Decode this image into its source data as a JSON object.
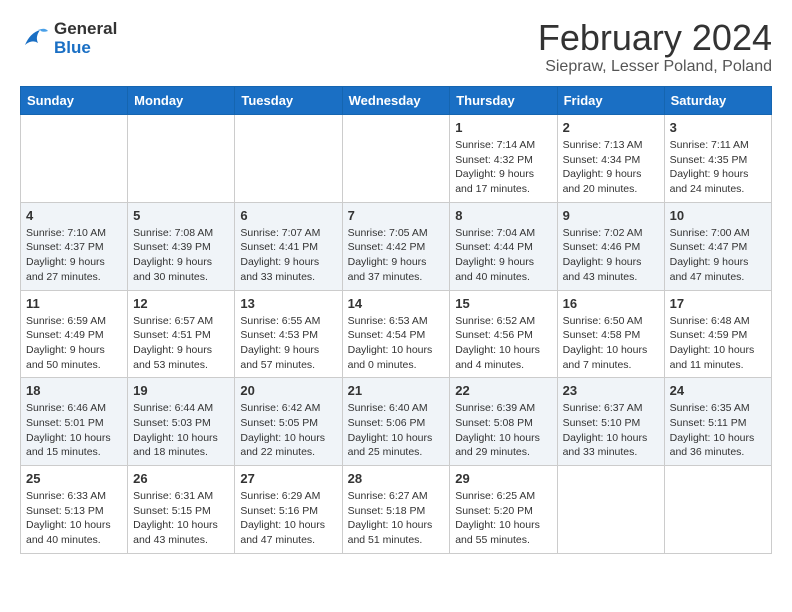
{
  "header": {
    "logo": {
      "general": "General",
      "blue": "Blue"
    },
    "title": "February 2024",
    "location": "Siepraw, Lesser Poland, Poland"
  },
  "days_of_week": [
    "Sunday",
    "Monday",
    "Tuesday",
    "Wednesday",
    "Thursday",
    "Friday",
    "Saturday"
  ],
  "weeks": [
    [
      {
        "day": "",
        "info": ""
      },
      {
        "day": "",
        "info": ""
      },
      {
        "day": "",
        "info": ""
      },
      {
        "day": "",
        "info": ""
      },
      {
        "day": "1",
        "info": "Sunrise: 7:14 AM\nSunset: 4:32 PM\nDaylight: 9 hours\nand 17 minutes."
      },
      {
        "day": "2",
        "info": "Sunrise: 7:13 AM\nSunset: 4:34 PM\nDaylight: 9 hours\nand 20 minutes."
      },
      {
        "day": "3",
        "info": "Sunrise: 7:11 AM\nSunset: 4:35 PM\nDaylight: 9 hours\nand 24 minutes."
      }
    ],
    [
      {
        "day": "4",
        "info": "Sunrise: 7:10 AM\nSunset: 4:37 PM\nDaylight: 9 hours\nand 27 minutes."
      },
      {
        "day": "5",
        "info": "Sunrise: 7:08 AM\nSunset: 4:39 PM\nDaylight: 9 hours\nand 30 minutes."
      },
      {
        "day": "6",
        "info": "Sunrise: 7:07 AM\nSunset: 4:41 PM\nDaylight: 9 hours\nand 33 minutes."
      },
      {
        "day": "7",
        "info": "Sunrise: 7:05 AM\nSunset: 4:42 PM\nDaylight: 9 hours\nand 37 minutes."
      },
      {
        "day": "8",
        "info": "Sunrise: 7:04 AM\nSunset: 4:44 PM\nDaylight: 9 hours\nand 40 minutes."
      },
      {
        "day": "9",
        "info": "Sunrise: 7:02 AM\nSunset: 4:46 PM\nDaylight: 9 hours\nand 43 minutes."
      },
      {
        "day": "10",
        "info": "Sunrise: 7:00 AM\nSunset: 4:47 PM\nDaylight: 9 hours\nand 47 minutes."
      }
    ],
    [
      {
        "day": "11",
        "info": "Sunrise: 6:59 AM\nSunset: 4:49 PM\nDaylight: 9 hours\nand 50 minutes."
      },
      {
        "day": "12",
        "info": "Sunrise: 6:57 AM\nSunset: 4:51 PM\nDaylight: 9 hours\nand 53 minutes."
      },
      {
        "day": "13",
        "info": "Sunrise: 6:55 AM\nSunset: 4:53 PM\nDaylight: 9 hours\nand 57 minutes."
      },
      {
        "day": "14",
        "info": "Sunrise: 6:53 AM\nSunset: 4:54 PM\nDaylight: 10 hours\nand 0 minutes."
      },
      {
        "day": "15",
        "info": "Sunrise: 6:52 AM\nSunset: 4:56 PM\nDaylight: 10 hours\nand 4 minutes."
      },
      {
        "day": "16",
        "info": "Sunrise: 6:50 AM\nSunset: 4:58 PM\nDaylight: 10 hours\nand 7 minutes."
      },
      {
        "day": "17",
        "info": "Sunrise: 6:48 AM\nSunset: 4:59 PM\nDaylight: 10 hours\nand 11 minutes."
      }
    ],
    [
      {
        "day": "18",
        "info": "Sunrise: 6:46 AM\nSunset: 5:01 PM\nDaylight: 10 hours\nand 15 minutes."
      },
      {
        "day": "19",
        "info": "Sunrise: 6:44 AM\nSunset: 5:03 PM\nDaylight: 10 hours\nand 18 minutes."
      },
      {
        "day": "20",
        "info": "Sunrise: 6:42 AM\nSunset: 5:05 PM\nDaylight: 10 hours\nand 22 minutes."
      },
      {
        "day": "21",
        "info": "Sunrise: 6:40 AM\nSunset: 5:06 PM\nDaylight: 10 hours\nand 25 minutes."
      },
      {
        "day": "22",
        "info": "Sunrise: 6:39 AM\nSunset: 5:08 PM\nDaylight: 10 hours\nand 29 minutes."
      },
      {
        "day": "23",
        "info": "Sunrise: 6:37 AM\nSunset: 5:10 PM\nDaylight: 10 hours\nand 33 minutes."
      },
      {
        "day": "24",
        "info": "Sunrise: 6:35 AM\nSunset: 5:11 PM\nDaylight: 10 hours\nand 36 minutes."
      }
    ],
    [
      {
        "day": "25",
        "info": "Sunrise: 6:33 AM\nSunset: 5:13 PM\nDaylight: 10 hours\nand 40 minutes."
      },
      {
        "day": "26",
        "info": "Sunrise: 6:31 AM\nSunset: 5:15 PM\nDaylight: 10 hours\nand 43 minutes."
      },
      {
        "day": "27",
        "info": "Sunrise: 6:29 AM\nSunset: 5:16 PM\nDaylight: 10 hours\nand 47 minutes."
      },
      {
        "day": "28",
        "info": "Sunrise: 6:27 AM\nSunset: 5:18 PM\nDaylight: 10 hours\nand 51 minutes."
      },
      {
        "day": "29",
        "info": "Sunrise: 6:25 AM\nSunset: 5:20 PM\nDaylight: 10 hours\nand 55 minutes."
      },
      {
        "day": "",
        "info": ""
      },
      {
        "day": "",
        "info": ""
      }
    ]
  ]
}
